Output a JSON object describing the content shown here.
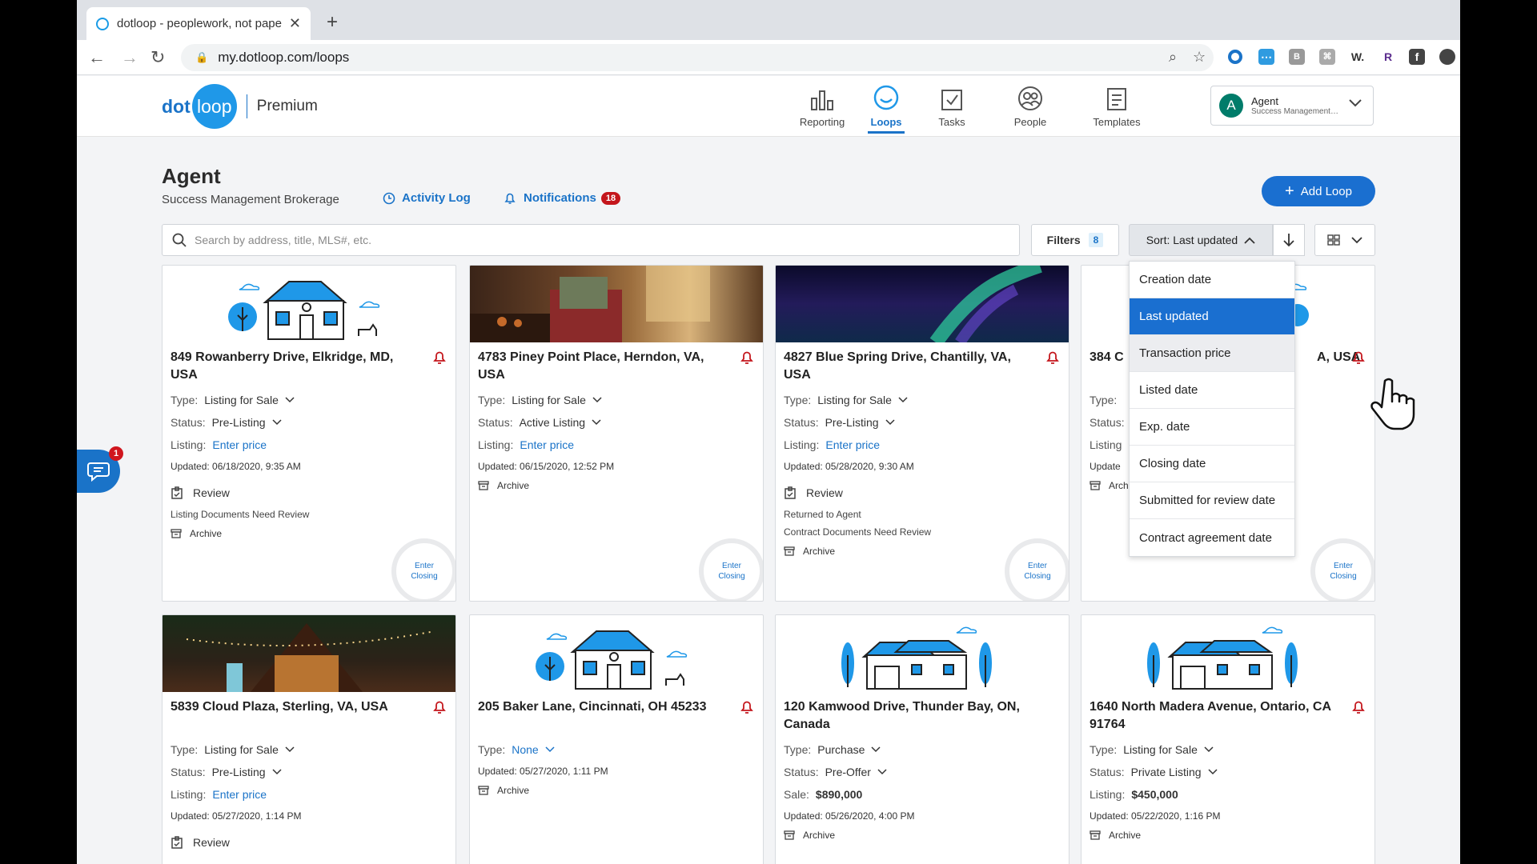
{
  "browser": {
    "tab_title": "dotloop - peoplework, not paperwork",
    "url": "my.dotloop.com/loops"
  },
  "app": {
    "logo_dot": "dot",
    "logo_loop": "loop",
    "plan": "Premium",
    "nav": [
      {
        "label": "Reporting",
        "icon": "bar-chart-icon"
      },
      {
        "label": "Loops",
        "icon": "loops-icon",
        "active": true
      },
      {
        "label": "Tasks",
        "icon": "checkbox-icon"
      },
      {
        "label": "People",
        "icon": "people-icon"
      },
      {
        "label": "Templates",
        "icon": "templates-icon"
      }
    ],
    "account": {
      "initial": "A",
      "name": "Agent",
      "org": "Success Management Brokerage"
    }
  },
  "page": {
    "title": "Agent",
    "subtitle": "Success Management Brokerage",
    "activity_log": "Activity Log",
    "notifications": "Notifications",
    "notifications_count": "18",
    "add_loop": "Add Loop",
    "search_placeholder": "Search by address, title, MLS#, etc.",
    "filters_label": "Filters",
    "filters_count": "8",
    "sort_label": "Sort: Last updated"
  },
  "sort_menu": [
    {
      "label": "Creation date"
    },
    {
      "label": "Last updated",
      "selected": true
    },
    {
      "label": "Transaction price",
      "hover": true
    },
    {
      "label": "Listed date"
    },
    {
      "label": "Exp. date"
    },
    {
      "label": "Closing date"
    },
    {
      "label": "Submitted for review date"
    },
    {
      "label": "Contract agreement date"
    }
  ],
  "cards": [
    {
      "address": "849 Rowanberry Drive, Elkridge, MD, USA",
      "type_label": "Type:",
      "type": "Listing for Sale",
      "status_label": "Status:",
      "status": "Pre-Listing",
      "price_label": "Listing:",
      "price": "Enter price",
      "updated": "Updated: 06/18/2020, 9:35 AM",
      "review": "Review",
      "notes": [
        "Listing Documents Need Review"
      ],
      "archive": "Archive",
      "closing": "Enter Closing"
    },
    {
      "address": "4783 Piney Point Place, Herndon, VA, USA",
      "type_label": "Type:",
      "type": "Listing for Sale",
      "status_label": "Status:",
      "status": "Active Listing",
      "price_label": "Listing:",
      "price": "Enter price",
      "updated": "Updated: 06/15/2020, 12:52 PM",
      "archive": "Archive",
      "closing": "Enter Closing"
    },
    {
      "address": "4827 Blue Spring Drive, Chantilly, VA, USA",
      "type_label": "Type:",
      "type": "Listing for Sale",
      "status_label": "Status:",
      "status": "Pre-Listing",
      "price_label": "Listing:",
      "price": "Enter price",
      "updated": "Updated: 05/28/2020, 9:30 AM",
      "review": "Review",
      "notes": [
        "Returned to Agent",
        "Contract Documents Need Review"
      ],
      "archive": "Archive",
      "closing": "Enter Closing"
    },
    {
      "address_left": "384 C",
      "address_right": "A, USA",
      "type_label": "Type:",
      "status_label": "Status:",
      "price_label": "Listing",
      "updated": "Update",
      "archive": "Arch",
      "closing": "Enter Closing"
    },
    {
      "address": "5839 Cloud Plaza, Sterling, VA, USA",
      "type_label": "Type:",
      "type": "Listing for Sale",
      "status_label": "Status:",
      "status": "Pre-Listing",
      "price_label": "Listing:",
      "price": "Enter price",
      "updated": "Updated: 05/27/2020, 1:14 PM",
      "review": "Review"
    },
    {
      "address": "205 Baker Lane, Cincinnati, OH 45233",
      "type_label": "Type:",
      "type": "None",
      "updated": "Updated: 05/27/2020, 1:11 PM",
      "archive": "Archive"
    },
    {
      "address": "120 Kamwood Drive, Thunder Bay, ON, Canada",
      "type_label": "Type:",
      "type": "Purchase",
      "status_label": "Status:",
      "status": "Pre-Offer",
      "price_label": "Sale:",
      "price": "$890,000",
      "updated": "Updated: 05/26/2020, 4:00 PM",
      "archive": "Archive"
    },
    {
      "address": "1640 North Madera Avenue, Ontario, CA 91764",
      "type_label": "Type:",
      "type": "Listing for Sale",
      "status_label": "Status:",
      "status": "Private Listing",
      "price_label": "Listing:",
      "price": "$450,000",
      "updated": "Updated: 05/22/2020, 1:16 PM",
      "archive": "Archive"
    }
  ],
  "chat_badge": "1",
  "colors": {
    "brand": "#1a73c8",
    "alert": "#c4161c",
    "selected": "#1a6fd0"
  }
}
